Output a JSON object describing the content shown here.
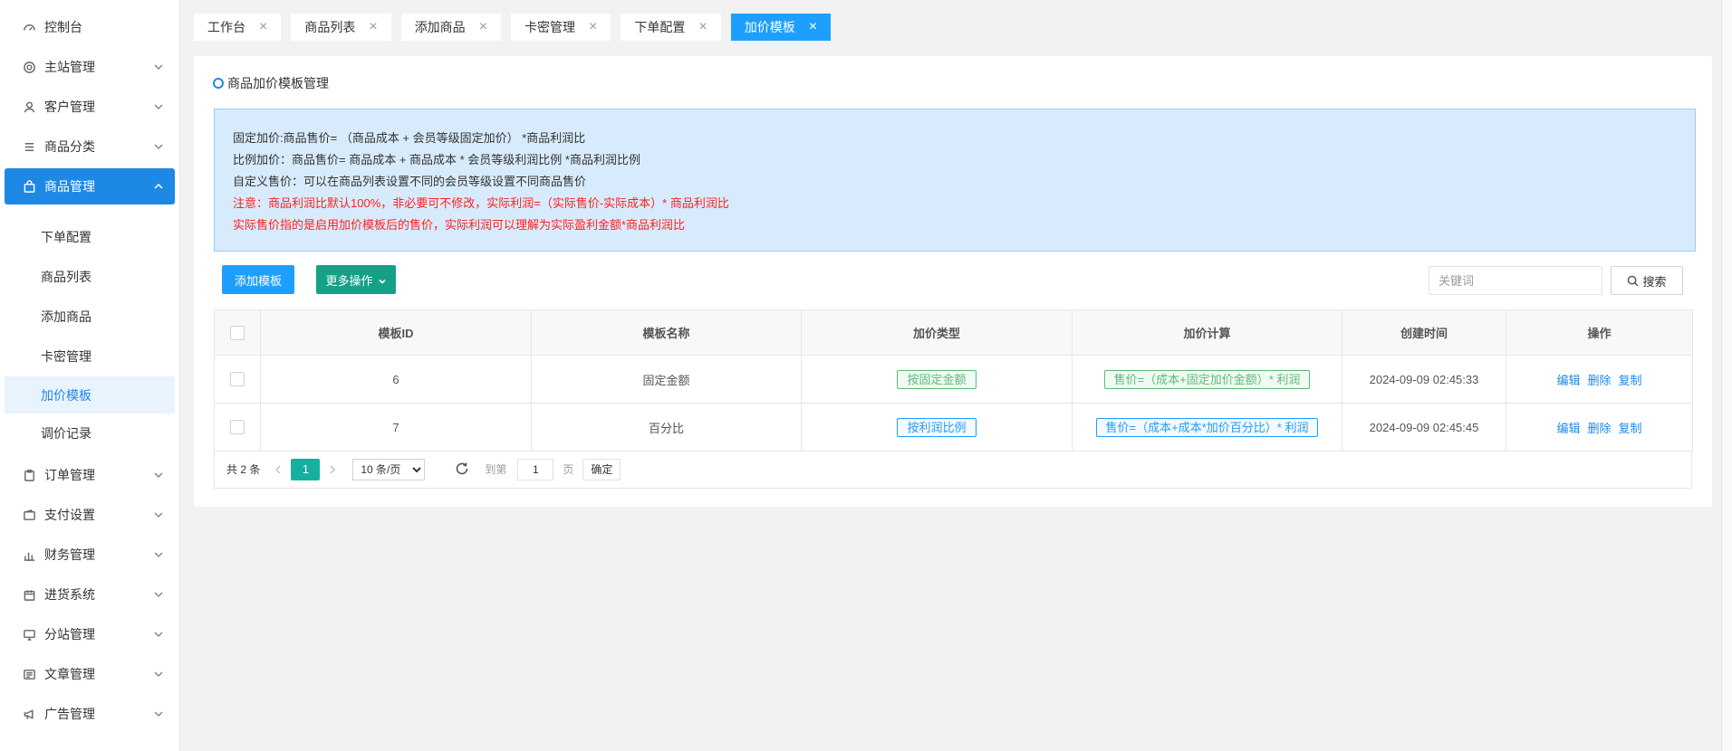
{
  "sidebar": {
    "items": [
      {
        "label": "控制台",
        "icon": "dashboard-icon"
      },
      {
        "label": "主站管理",
        "icon": "gear-icon"
      },
      {
        "label": "客户管理",
        "icon": "user-icon"
      },
      {
        "label": "商品分类",
        "icon": "list-icon"
      },
      {
        "label": "商品管理",
        "icon": "bag-icon"
      }
    ],
    "sub_items": [
      {
        "label": "下单配置"
      },
      {
        "label": "商品列表"
      },
      {
        "label": "添加商品"
      },
      {
        "label": "卡密管理"
      },
      {
        "label": "加价模板"
      },
      {
        "label": "调价记录"
      }
    ],
    "items_after": [
      {
        "label": "订单管理",
        "icon": "clipboard-icon"
      },
      {
        "label": "支付设置",
        "icon": "wallet-icon"
      },
      {
        "label": "财务管理",
        "icon": "bar-chart-icon"
      },
      {
        "label": "进货系统",
        "icon": "box-icon"
      },
      {
        "label": "分站管理",
        "icon": "monitor-icon"
      },
      {
        "label": "文章管理",
        "icon": "article-icon"
      },
      {
        "label": "广告管理",
        "icon": "megaphone-icon"
      }
    ]
  },
  "tabs": [
    {
      "label": "工作台"
    },
    {
      "label": "商品列表"
    },
    {
      "label": "添加商品"
    },
    {
      "label": "卡密管理"
    },
    {
      "label": "下单配置"
    },
    {
      "label": "加价模板"
    }
  ],
  "card": {
    "title": "商品加价模板管理"
  },
  "notice": {
    "line1": "固定加价:商品售价= （商品成本 + 会员等级固定加价） *商品利润比",
    "line2": "比例加价：商品售价= 商品成本 + 商品成本 * 会员等级利润比例 *商品利润比例",
    "line3": "自定义售价：可以在商品列表设置不同的会员等级设置不同商品售价",
    "line4": "注意：商品利润比默认100%，非必要可不修改，实际利润=（实际售价-实际成本）* 商品利润比",
    "line5": "实际售价指的是启用加价模板后的售价，实际利润可以理解为实际盈利金额*商品利润比",
    "warning_color": "#ff1f1f"
  },
  "toolbar": {
    "add_label": "添加模板",
    "more_label": "更多操作",
    "search_placeholder": "关键词",
    "search_label": "搜索"
  },
  "table": {
    "headers": [
      "模板ID",
      "模板名称",
      "加价类型",
      "加价计算",
      "创建时间",
      "操作"
    ],
    "rows": [
      {
        "id": "6",
        "name": "固定金额",
        "type": "按固定金额",
        "calc": "售价=（成本+固定加价金额）* 利润",
        "created": "2024-09-09 02:45:33"
      },
      {
        "id": "7",
        "name": "百分比",
        "type": "按利润比例",
        "calc": "售价=（成本+成本*加价百分比）* 利润",
        "created": "2024-09-09 02:45:45"
      }
    ],
    "actions": {
      "edit": "编辑",
      "delete": "删除",
      "copy": "复制"
    }
  },
  "pager": {
    "total": "共 2 条",
    "current": "1",
    "page_size": "10 条/页",
    "goto_label": "到第",
    "goto_value": "1",
    "page_unit": "页",
    "confirm": "确定"
  },
  "colors": {
    "primary": "#1E88E5",
    "tab_active": "#1E9FFF",
    "teal": "#16a085",
    "green_tag": "#5FB878"
  }
}
